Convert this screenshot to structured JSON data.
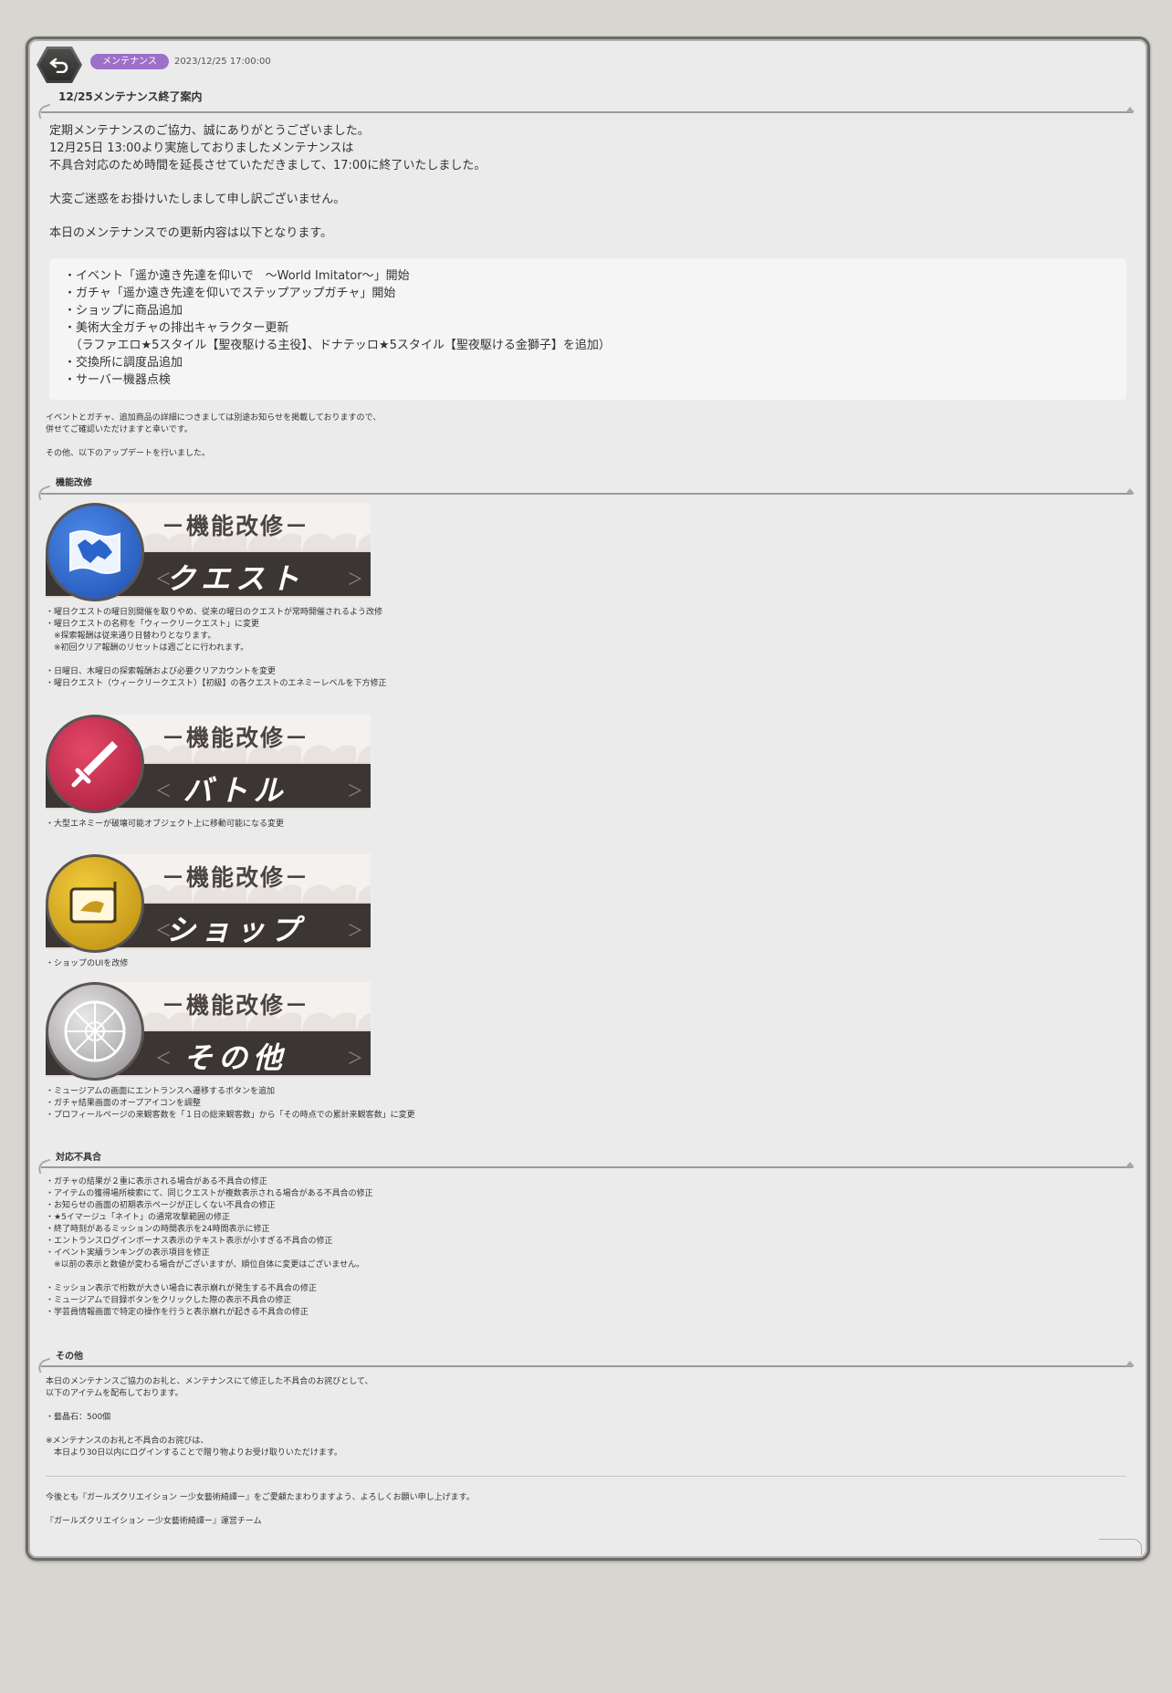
{
  "header": {
    "category_badge": "メンテナンス",
    "date": "2023/12/25 17:00:00",
    "title": "12/25メンテナンス終了案内"
  },
  "intro": {
    "lines": [
      "定期メンテナンスのご協力、誠にありがとうございました。",
      "12月25日 13:00より実施しておりましたメンテナンスは",
      "不具合対応のため時間を延長させていただきまして、17:00に終了いたしました。"
    ],
    "apology": "大変ご迷惑をお掛けいたしまして申し訳ございません。",
    "update_intro": "本日のメンテナンスでの更新内容は以下となります。"
  },
  "update_list": [
    "・イベント「遥か遠き先達を仰いで　～World Imitator～」開始",
    "・ガチャ「遥か遠き先達を仰いでステップアップガチャ」開始",
    "・ショップに商品追加",
    "・美術大全ガチャの排出キャラクター更新",
    "　（ラファエロ★5スタイル【聖夜駆ける主役】、ドナテッロ★5スタイル【聖夜駆ける金獅子】を追加）",
    "・交換所に調度品追加",
    "・サーバー機器点検"
  ],
  "notes": [
    "イベントとガチャ、追加商品の詳細につきましては別途お知らせを掲載しておりますので、",
    "併せてご確認いただけますと幸いです。",
    "",
    "その他、以下のアップデートを行いました。"
  ],
  "sections": {
    "improvements_title": "機能改修",
    "bugfix_title": "対応不具合",
    "other_title": "その他"
  },
  "banners": {
    "header_text": "－機能改修－",
    "quest": "クエスト",
    "battle": "バトル",
    "shop": "ショップ",
    "other": "その他",
    "arrow_left": "＜",
    "arrow_right": "＞"
  },
  "quest_items": [
    "・曜日クエストの曜日別開催を取りやめ、従来の曜日のクエストが常時開催されるよう改修",
    "・曜日クエストの名称を「ウィークリークエスト」に変更",
    "　※探索報酬は従来通り日替わりとなります。",
    "　※初回クリア報酬のリセットは週ごとに行われます。",
    "",
    "・日曜日、木曜日の探索報酬および必要クリアカウントを変更",
    "・曜日クエスト（ウィークリークエスト）【初級】の各クエストのエネミーレベルを下方修正"
  ],
  "battle_items": [
    "・大型エネミーが破壊可能オブジェクト上に移動可能になる変更"
  ],
  "shop_items": [
    "・ショップのUIを改修"
  ],
  "other_items": [
    "・ミュージアムの画面にエントランスへ遷移するボタンを追加",
    "・ガチャ結果画面のオープアイコンを調整",
    "・プロフィールページの来観客数を「１日の総来観客数」から「その時点での累計来観客数」に変更"
  ],
  "bugfix_items": [
    "・ガチャの結果が２重に表示される場合がある不具合の修正",
    "・アイテムの獲得場所検索にて、同じクエストが複数表示される場合がある不具合の修正",
    "・お知らせの画面の初期表示ページが正しくない不具合の修正",
    "・★5イマージュ「ネイト」の通常攻撃範囲の修正",
    "・終了時刻があるミッションの時間表示を24時間表示に修正",
    "・エントランスログインボーナス表示のテキスト表示が小すぎる不具合の修正",
    "・イベント実績ランキングの表示項目を修正",
    "　※以前の表示と数値が変わる場合がございますが、順位自体に変更はございません。",
    "",
    "・ミッション表示で桁数が大きい場合に表示崩れが発生する不具合の修正",
    "・ミュージアムで目録ボタンをクリックした際の表示不具合の修正",
    "・学芸員情報画面で特定の操作を行うと表示崩れが起きる不具合の修正"
  ],
  "other_text": [
    "本日のメンテナンスご協力のお礼と、メンテナンスにて修正した不具合のお詫びとして、",
    "以下のアイテムを配布しております。",
    "",
    "・藝晶石：500個",
    "",
    "※メンテナンスのお礼と不具合のお詫びは、",
    "　本日より30日以内にログインすることで贈り物よりお受け取りいただけます。"
  ],
  "closing": {
    "message": "今後とも『ガールズクリエイション ー少女藝術綺譚ー』をご愛顧たまわりますよう、よろしくお願い申し上げます。",
    "signature": "『ガールズクリエイション ー少女藝術綺譚ー』運営チーム"
  },
  "icons": {
    "back": "back-arrow-icon",
    "quest": "map-icon",
    "battle": "sword-icon",
    "shop": "signboard-icon",
    "other": "rose-window-icon"
  },
  "colors": {
    "badge": "#9d6fc8",
    "quest_circle": "#2a63c9",
    "battle_circle": "#c8294c",
    "shop_circle": "#d8a81a",
    "other_circle": "#a8a6a8"
  }
}
